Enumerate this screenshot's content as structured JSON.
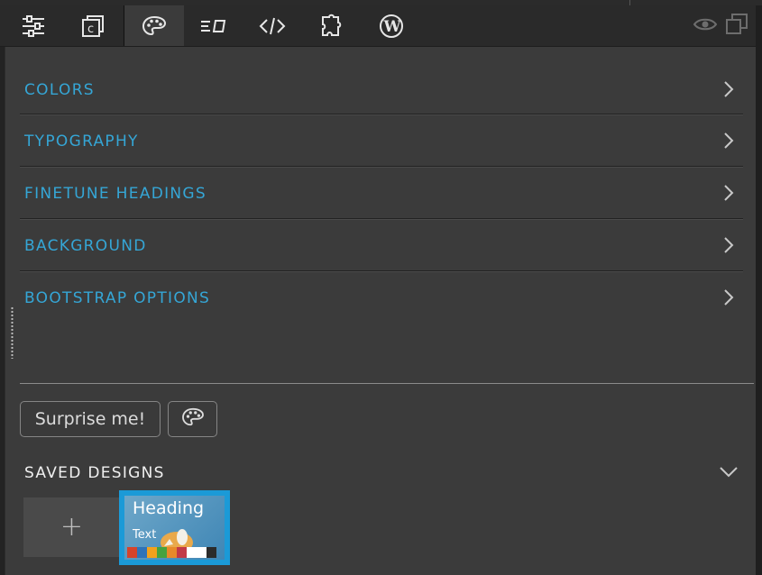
{
  "toolbar": {
    "tools": [
      {
        "name": "settings-sliders-icon"
      },
      {
        "name": "components-icon"
      },
      {
        "name": "design-palette-icon",
        "active": true
      },
      {
        "name": "text-format-icon"
      },
      {
        "name": "code-icon"
      },
      {
        "name": "plugins-icon"
      },
      {
        "name": "wordpress-icon"
      }
    ],
    "right": [
      {
        "name": "preview-eye-icon"
      },
      {
        "name": "duplicate-icon"
      }
    ]
  },
  "menu": {
    "items": [
      {
        "label": "COLORS"
      },
      {
        "label": "TYPOGRAPHY"
      },
      {
        "label": "FINETUNE HEADINGS"
      },
      {
        "label": "BACKGROUND"
      },
      {
        "label": "BOOTSTRAP OPTIONS"
      }
    ]
  },
  "actions": {
    "surprise_label": "Surprise me!"
  },
  "saved": {
    "title": "SAVED DESIGNS",
    "add_label": "+",
    "designs": [
      {
        "heading": "Heading",
        "text": "Text",
        "swatches": [
          "#d5432b",
          "#2f73b8",
          "#f2a11d",
          "#46a23f",
          "#e8892a",
          "#c23a47",
          "#ffffff",
          "#ffffff",
          "#2b2b2b"
        ]
      }
    ]
  },
  "colors": {
    "accent": "#35a6d6",
    "thumb_border": "#1b9ad7",
    "panel_bg": "#3b3b3b",
    "toolbar_bg": "#2a2a2a"
  }
}
